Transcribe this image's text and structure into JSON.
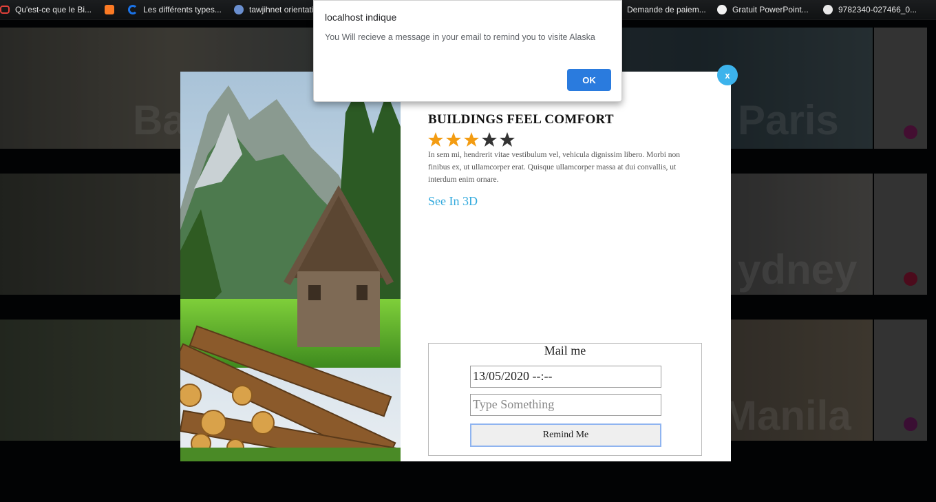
{
  "bookmarks": [
    {
      "label": "Qu'est-ce que le Bi...",
      "icon": "bookmark-red-icon"
    },
    {
      "label": "",
      "icon": "xampp-icon"
    },
    {
      "label": "Les différents types...",
      "icon": "loading-circle-icon"
    },
    {
      "label": "tawjihnet orientati",
      "icon": "globe-swirl-icon"
    },
    {
      "label": "Demande de paiem...",
      "icon": "page-icon"
    },
    {
      "label": "Gratuit PowerPoint...",
      "icon": "smiley-icon"
    },
    {
      "label": "9782340-027466_0...",
      "icon": "globe-icon"
    }
  ],
  "background_cards": {
    "left_labels": [
      "Ba",
      "",
      ""
    ],
    "right_labels": [
      "Paris",
      "ydney",
      "Manila"
    ]
  },
  "modal": {
    "close_label": "x",
    "title": "BUILDINGS FEEL COMFORT",
    "rating": {
      "value": 3,
      "max": 5
    },
    "description": "In sem mi, hendrerit vitae vestibulum vel, vehicula dignissim libero. Morbi non finibus ex, ut ullamcorper erat. Quisque ullamcorper massa at dui convallis, ut interdum enim ornare.",
    "see_3d_link": "See In 3D",
    "mail_form": {
      "title": "Mail me",
      "datetime_value": "13/05/2020 --:--",
      "message_placeholder": "Type Something",
      "remind_button": "Remind Me"
    }
  },
  "alert": {
    "title": "localhost indique",
    "message": "You Will recieve a message in your email to remind you to visite Alaska",
    "ok_button": "OK"
  },
  "colors": {
    "accent": "#3cb3ec",
    "star_filled": "#f39c12",
    "star_empty": "#333333",
    "ok_button": "#2a7bde"
  }
}
